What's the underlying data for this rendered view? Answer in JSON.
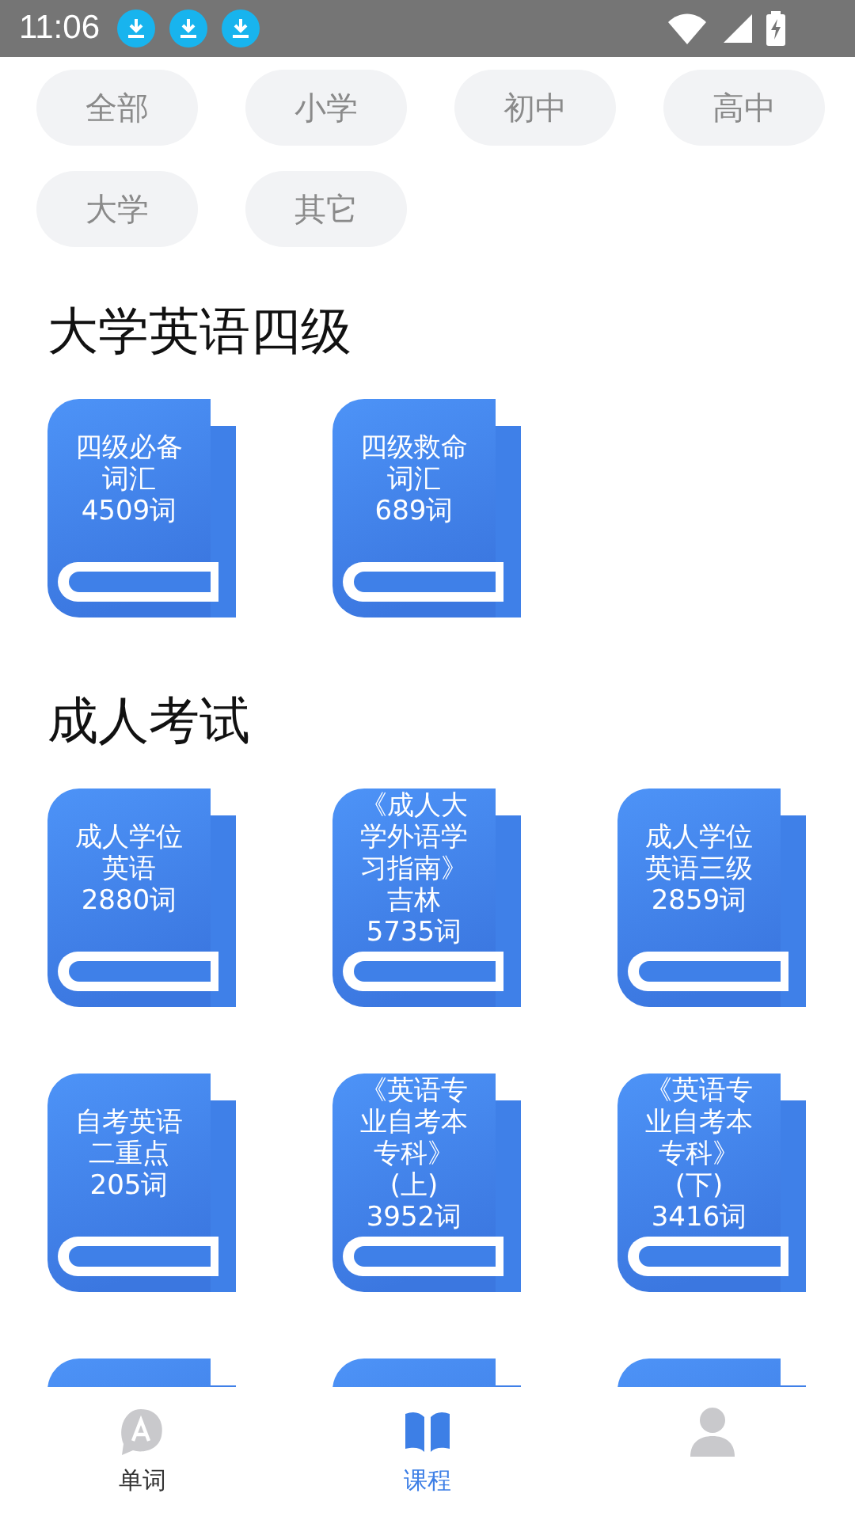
{
  "status_bar": {
    "time": "11:06",
    "notifications": [
      {
        "kind": "download"
      },
      {
        "kind": "download"
      },
      {
        "kind": "download"
      }
    ]
  },
  "filters": [
    {
      "label": "全部",
      "selected": false
    },
    {
      "label": "小学",
      "selected": false
    },
    {
      "label": "初中",
      "selected": false
    },
    {
      "label": "高中",
      "selected": false
    },
    {
      "label": "大学",
      "selected": false
    },
    {
      "label": "其它",
      "selected": false
    }
  ],
  "sections": [
    {
      "title": "大学英语四级",
      "books": [
        {
          "label": "四级必备词汇4509词"
        },
        {
          "label": "四级救命词汇689词"
        }
      ]
    },
    {
      "title": "成人考试",
      "books": [
        {
          "label": "成人学位英语2880词"
        },
        {
          "label": "《成人大学外语学习指南》吉林5735词"
        },
        {
          "label": "成人学位英语三级2859词"
        },
        {
          "label": "自考英语二重点205词"
        },
        {
          "label": "《英语专业自考本专科》(上)3952词"
        },
        {
          "label": "《英语专业自考本专科》(下)3416词"
        },
        {
          "kind": "partial"
        },
        {
          "kind": "partial"
        },
        {
          "kind": "partial"
        }
      ]
    }
  ],
  "bottom_nav": [
    {
      "kind": "word",
      "label": "单词",
      "selected": false
    },
    {
      "kind": "course",
      "label": "课程",
      "selected": true
    },
    {
      "kind": "profile",
      "selected": false
    }
  ]
}
